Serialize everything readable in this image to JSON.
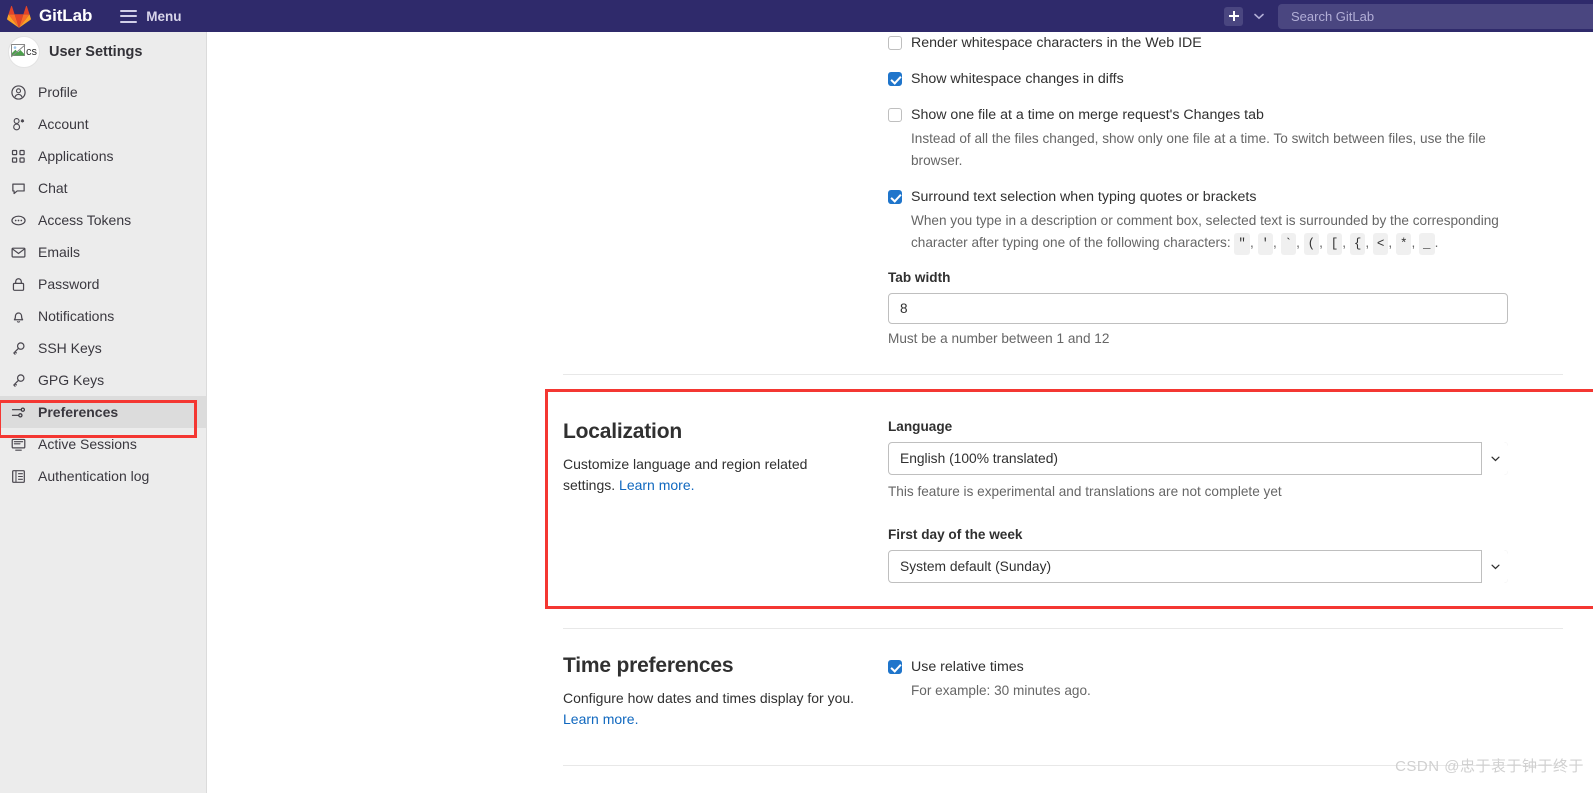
{
  "topbar": {
    "brand": "GitLab",
    "menu_label": "Menu",
    "search_placeholder": "Search GitLab",
    "brand_color": "#2f2a6b",
    "new_button_icon": "plus-icon",
    "chevron_icon": "chevron-down-icon"
  },
  "sidebar": {
    "title": "User Settings",
    "avatar_alt": "cs",
    "active_item": "Preferences",
    "items": [
      {
        "label": "Profile",
        "icon": "user-circle-icon"
      },
      {
        "label": "Account",
        "icon": "account-icon"
      },
      {
        "label": "Applications",
        "icon": "applications-grid-icon"
      },
      {
        "label": "Chat",
        "icon": "chat-bubble-icon"
      },
      {
        "label": "Access Tokens",
        "icon": "token-icon"
      },
      {
        "label": "Emails",
        "icon": "envelope-icon"
      },
      {
        "label": "Password",
        "icon": "lock-icon"
      },
      {
        "label": "Notifications",
        "icon": "bell-icon"
      },
      {
        "label": "SSH Keys",
        "icon": "key-icon"
      },
      {
        "label": "GPG Keys",
        "icon": "key-icon"
      },
      {
        "label": "Preferences",
        "icon": "sliders-icon"
      },
      {
        "label": "Active Sessions",
        "icon": "monitor-icon"
      },
      {
        "label": "Authentication log",
        "icon": "log-list-icon"
      }
    ]
  },
  "behavior": {
    "render_whitespace": {
      "label": "Render whitespace characters in the Web IDE",
      "checked": false
    },
    "show_whitespace_diffs": {
      "label": "Show whitespace changes in diffs",
      "checked": true
    },
    "one_file_at_a_time": {
      "label": "Show one file at a time on merge request's Changes tab",
      "checked": false,
      "help": "Instead of all the files changed, show only one file at a time. To switch between files, use the file browser."
    },
    "surround_selection": {
      "label": "Surround text selection when typing quotes or brackets",
      "checked": true,
      "help_prefix": "When you type in a description or comment box, selected text is surrounded by the corresponding character after typing one of the following characters:",
      "characters": [
        "\"",
        "'",
        "`",
        "(",
        "[",
        "{",
        "<",
        "*",
        "_"
      ]
    },
    "tab_width": {
      "label": "Tab width",
      "value": "8",
      "help": "Must be a number between 1 and 12"
    }
  },
  "localization": {
    "title": "Localization",
    "description": "Customize language and region related settings.",
    "learn_more": "Learn more.",
    "highlighted": true,
    "highlight_color": "#f43732",
    "language": {
      "label": "Language",
      "value": "English (100% translated)",
      "help": "This feature is experimental and translations are not complete yet"
    },
    "first_day": {
      "label": "First day of the week",
      "value": "System default (Sunday)"
    }
  },
  "time_preferences": {
    "title": "Time preferences",
    "description": "Configure how dates and times display for you.",
    "learn_more": "Learn more.",
    "use_relative_times": {
      "label": "Use relative times",
      "checked": true,
      "help": "For example: 30 minutes ago."
    }
  },
  "watermark": "CSDN @忠于衷于钟于终于"
}
